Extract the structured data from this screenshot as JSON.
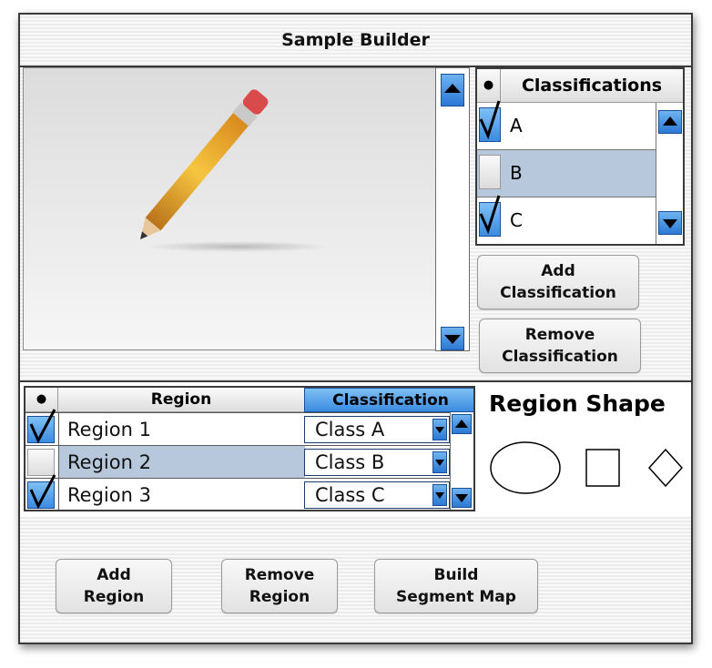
{
  "window": {
    "title": "Sample Builder"
  },
  "classifications_panel": {
    "header": "Classifications",
    "header_dot": "●",
    "items": [
      {
        "label": "A",
        "checked": true,
        "selected": false
      },
      {
        "label": "B",
        "checked": false,
        "selected": true
      },
      {
        "label": "C",
        "checked": true,
        "selected": false
      }
    ],
    "add_label_1": "Add",
    "add_label_2": "Classification",
    "remove_label_1": "Remove",
    "remove_label_2": "Classification"
  },
  "regions_table": {
    "header_dot": "●",
    "col_region": "Region",
    "col_classification": "Classification",
    "rows": [
      {
        "region": "Region 1",
        "classification": "Class A",
        "checked": true,
        "selected": false
      },
      {
        "region": "Region 2",
        "classification": "Class B",
        "checked": false,
        "selected": true
      },
      {
        "region": "Region 3",
        "classification": "Class C",
        "checked": true,
        "selected": false
      }
    ]
  },
  "region_shape": {
    "title": "Region Shape",
    "shapes": [
      "ellipse-icon",
      "square-icon",
      "diamond-icon"
    ]
  },
  "actions": {
    "add_region_1": "Add",
    "add_region_2": "Region",
    "remove_region_1": "Remove",
    "remove_region_2": "Region",
    "build_1": "Build",
    "build_2": "Segment Map"
  },
  "colors": {
    "accent": "#3b8be0",
    "selected_row": "#b7c8dc",
    "border": "#3a3a3a"
  }
}
